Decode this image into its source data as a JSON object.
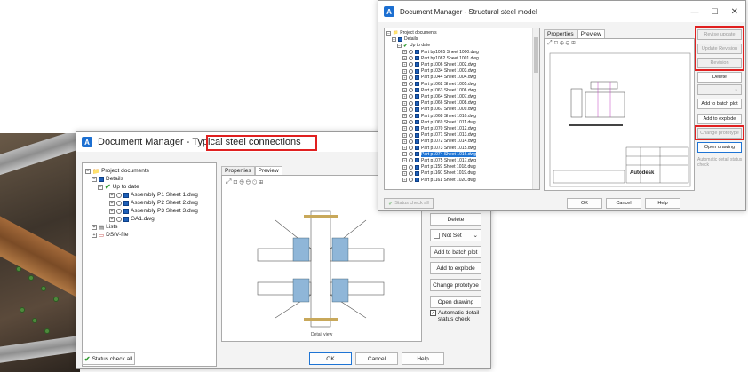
{
  "win1": {
    "title_prefix": "Document Manager -",
    "title_suffix": "Typical steel connections",
    "tree": {
      "root": "Project documents",
      "details": "Details",
      "uptodate": "Up to date",
      "items": [
        "Assembly P1 Sheet 1.dwg",
        "Assembly P2 Sheet 2.dwg",
        "Assembly P3 Sheet 3.dwg",
        "GA1.dwg"
      ],
      "lists": "Lists",
      "dstv": "DStV-file"
    },
    "tabs": [
      "Properties",
      "Preview"
    ],
    "preview_caption": "Detail view",
    "buttons": {
      "delete": "Delete",
      "notset": "Not Set",
      "batch": "Add to batch plot",
      "explode": "Add to explode",
      "prototype": "Change prototype",
      "open": "Open drawing",
      "auto": "Automatic detail status check"
    },
    "status_check": "Status check all",
    "ok": "OK",
    "cancel": "Cancel",
    "help": "Help"
  },
  "win2": {
    "title": "Document Manager - Structural steel model",
    "tree": {
      "root": "Project documents",
      "details": "Details",
      "uptodate": "Up to date",
      "items": [
        "Part bp1065 Sheet 1000.dwg",
        "Part bp1082 Sheet 1001.dwg",
        "Part p1006 Sheet 1002.dwg",
        "Part p1034 Sheet 1003.dwg",
        "Part p1044 Sheet 1004.dwg",
        "Part p1062 Sheet 1005.dwg",
        "Part p1063 Sheet 1006.dwg",
        "Part p1064 Sheet 1007.dwg",
        "Part p1066 Sheet 1008.dwg",
        "Part p1067 Sheet 1009.dwg",
        "Part p1068 Sheet 1010.dwg",
        "Part p1069 Sheet 1011.dwg",
        "Part p1070 Sheet 1012.dwg",
        "Part p1071 Sheet 1013.dwg",
        "Part p1072 Sheet 1014.dwg",
        "Part p1073 Sheet 1015.dwg",
        "Part p1074 Sheet 1016.dwg",
        "Part p1075 Sheet 1017.dwg",
        "Part p1159 Sheet 1018.dwg",
        "Part p1160 Sheet 1019.dwg",
        "Part p1161 Sheet 1020.dwg"
      ],
      "selected_index": 16
    },
    "tabs": [
      "Properties",
      "Preview"
    ],
    "buttons": {
      "revise_update": "Revise update",
      "update_revision": "Update Revision",
      "revision": "Revision",
      "delete": "Delete",
      "batch": "Add to batch plot",
      "explode": "Add to explode",
      "prototype": "Change prototype",
      "open": "Open drawing",
      "auto": "Automatic detail status check"
    },
    "status_check": "Status check all",
    "ok": "OK",
    "cancel": "Cancel",
    "help": "Help",
    "autodesk": "Autodesk"
  },
  "colors": {
    "accent": "#1e74d4",
    "highlight": "#e02020",
    "check": "#2e9a2e"
  }
}
